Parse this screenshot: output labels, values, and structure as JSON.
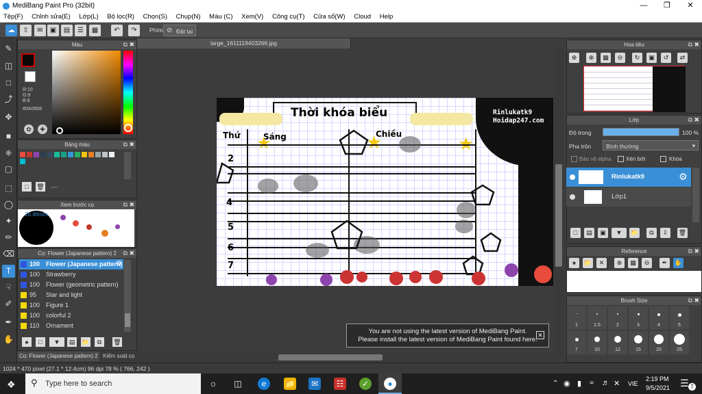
{
  "window": {
    "title": "MediBang Paint Pro (32bit)"
  },
  "menu": [
    "Tệp(F)",
    "Chỉnh sửa(E)",
    "Lớp(L)",
    "Bộ lọc(R)",
    "Chọn(S)",
    "Chụp(N)",
    "Màu (C)",
    "Xem(V)",
    "Công cụ(T)",
    "Cửa sổ(W)",
    "Cloud",
    "Help"
  ],
  "toolbar": {
    "phim_label": "Phím",
    "reset_label": "Đặt lại"
  },
  "color_panel": {
    "title": "Màu",
    "r": "R:10",
    "g": "G:9",
    "b": "B:8",
    "hex": "#0A0908",
    "fg_color": "#0A0908"
  },
  "palette_panel": {
    "title": "Bảng màu",
    "swatches": [
      "#e74c3c",
      "#c0392b",
      "#8e44ad",
      "#2c3e50",
      "#34495e",
      "#1abc9c",
      "#16a085",
      "#3498db",
      "#27ae60",
      "#f1c40f",
      "#e67e22",
      "#95a5a6",
      "#bdc3c7",
      "#ecf0f1",
      "#00bcd4"
    ],
    "dash_label": "----"
  },
  "preview_panel": {
    "title": "Xem trước cọ",
    "size": "26.46mm"
  },
  "brush_panel": {
    "title": "Cọ: Flower (Japanese pattern) 2",
    "items": [
      {
        "size": "100",
        "name": "Flower (Japanese pattern) 2",
        "color": "#2f55e0"
      },
      {
        "size": "100",
        "name": "Strawberry",
        "color": "#2f55e0"
      },
      {
        "size": "100",
        "name": "Flower (geometric pattern)",
        "color": "#2f55e0"
      },
      {
        "size": "95",
        "name": "Star and light",
        "color": "#f5d90a"
      },
      {
        "size": "100",
        "name": "Figure 1",
        "color": "#f5d90a"
      },
      {
        "size": "100",
        "name": "colorful 2",
        "color": "#f5d90a"
      },
      {
        "size": "110",
        "name": "Ornament",
        "color": "#f5d90a"
      }
    ],
    "bottom_tabs": [
      "Cọ: Flower (Japanese pattern) 2",
      "Kiểm soát cọ"
    ]
  },
  "document": {
    "tab_name": "large_1611119403266.jpg",
    "heading": "Thời khóa biểu",
    "watermark_1": "Rinlukatk9",
    "watermark_2": "Hoidap247.com",
    "col_thu": "Thứ",
    "col_sang": "Sáng",
    "col_chieu": "Chiều",
    "row_labels": [
      "2",
      "4",
      "5",
      "6",
      "7"
    ]
  },
  "notice": {
    "line1": "You are not using the latest version of MediBang Paint.",
    "line2": "Please install the latest version of MediBang Paint found here."
  },
  "navigator_panel": {
    "title": "Hoa tiêu"
  },
  "layer_panel": {
    "title": "Lớp",
    "opacity_label": "Độ trong",
    "opacity_value": "100 %",
    "opacity_fraction": 1.0,
    "blend_label": "Pha trộn",
    "blend_value": "Bình thường",
    "alpha_label": "Bảo vệ alpha",
    "clip_label": "Xén bớt",
    "lock_label": "Khóa",
    "layers": [
      {
        "name": "Rinlukatk9",
        "selected": true
      },
      {
        "name": "Lớp1",
        "selected": false
      }
    ]
  },
  "reference_panel": {
    "title": "Reference"
  },
  "brush_size_panel": {
    "title": "Brush Size",
    "row1": [
      "1",
      "1.5",
      "2",
      "3",
      "4",
      "5"
    ],
    "row2": [
      "7",
      "10",
      "12",
      "15",
      "20",
      "25"
    ]
  },
  "status": {
    "text": "1024 * 470 pixel   (27.1 * 12.4cm)   96 dpi   78 %   ( 766, 242 )"
  },
  "taskbar": {
    "search_placeholder": "Type here to search",
    "time": "2:19 PM",
    "date": "9/5/2021",
    "lang": "VIE",
    "notif_count": "7"
  }
}
